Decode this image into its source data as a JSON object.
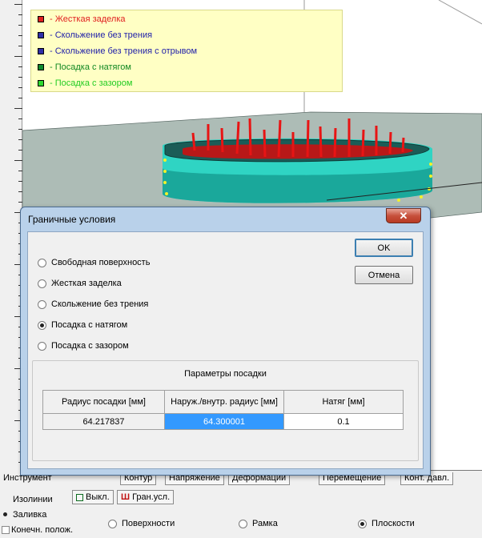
{
  "legend": {
    "items": [
      {
        "label": "- Жесткая заделка",
        "color": "#e02020",
        "text_color": "#e02020"
      },
      {
        "label": "- Скольжение без трения",
        "color": "#2e2ea8",
        "text_color": "#2222aa"
      },
      {
        "label": "- Скольжение без трения с отрывом",
        "color": "#2e2ea8",
        "text_color": "#2222aa"
      },
      {
        "label": "- Посадка с натягом",
        "color": "#0e8a2e",
        "text_color": "#118822"
      },
      {
        "label": "- Посадка с зазором",
        "color": "#2ed82e",
        "text_color": "#22cc22"
      }
    ]
  },
  "dialog": {
    "title": "Граничные условия",
    "close_label": "✕",
    "ok_label": "OK",
    "cancel_label": "Отмена",
    "options": [
      {
        "label": "Свободная поверхность",
        "checked": false
      },
      {
        "label": "Жесткая заделка",
        "checked": false
      },
      {
        "label": "Скольжение без трения",
        "checked": false
      },
      {
        "label": "Посадка с натягом",
        "checked": true
      },
      {
        "label": "Посадка с зазором",
        "checked": false
      }
    ],
    "params_title": "Параметры посадки",
    "table": {
      "headers": [
        "Радиус посадки [мм]",
        "Наруж./внутр. радиус [мм]",
        "Натяг [мм]"
      ],
      "row": [
        "64.217837",
        "64.300001",
        "0.1"
      ]
    }
  },
  "tabs": {
    "instrument": "Инструмент",
    "items": [
      "Контур",
      "Напряжение",
      "Деформации",
      "Перемещение",
      "Конт. давл."
    ]
  },
  "bottom": {
    "radio_isolines": "Изолинии",
    "radio_fill": "Заливка",
    "radio_final": "Конечн. полож.",
    "off_button": "Выкл.",
    "bc_button": "Гран.усл.",
    "bc_icon": "Ш",
    "radio_surfaces": "Поверхности",
    "radio_frame": "Рамка",
    "radio_planes": "Плоскости"
  }
}
